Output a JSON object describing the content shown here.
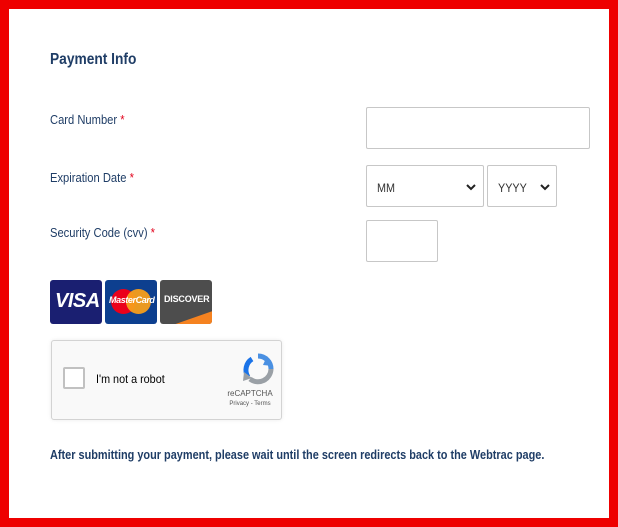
{
  "form": {
    "title": "Payment Info",
    "required_marker": "*",
    "card_number": {
      "label": "Card Number",
      "value": ""
    },
    "expiration": {
      "label": "Expiration Date",
      "month_value": "MM",
      "year_value": "YYYY"
    },
    "security_code": {
      "label": "Security Code (cvv)",
      "value": ""
    }
  },
  "cards": {
    "visa": "VISA",
    "mastercard": "MasterCard",
    "discover": "DISCOVER"
  },
  "captcha": {
    "label": "I'm not a robot",
    "brand": "reCAPTCHA",
    "privacy": "Privacy",
    "terms": "Terms",
    "separator": " - "
  },
  "note": "After submitting your payment, please wait until the screen redirects back to the Webtrac page.",
  "colors": {
    "frame": "#ee0000",
    "heading": "#1f3d66",
    "required": "#e2001a"
  },
  "icons": {
    "select_caret": "chevron-down-icon",
    "captcha_logo": "recaptcha-logo-icon"
  }
}
